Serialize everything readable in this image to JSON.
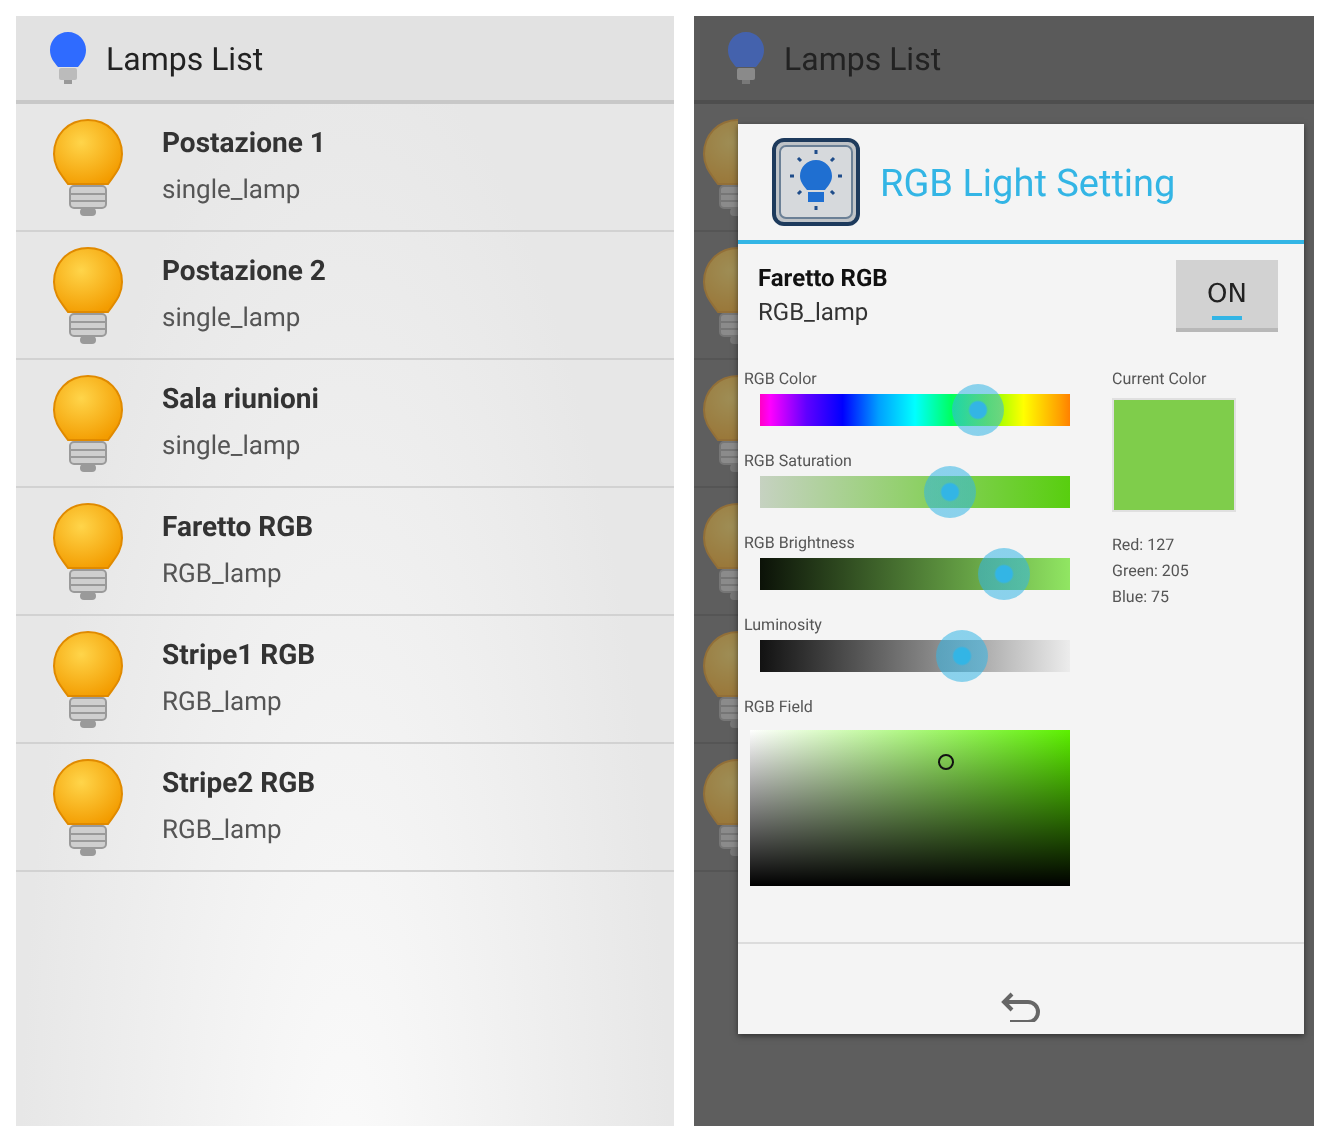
{
  "lamps_screen": {
    "title": "Lamps List",
    "lamps": [
      {
        "name": "Postazione 1",
        "type": "single_lamp"
      },
      {
        "name": "Postazione 2",
        "type": "single_lamp"
      },
      {
        "name": "Sala riunioni",
        "type": "single_lamp"
      },
      {
        "name": "Faretto RGB",
        "type": "RGB_lamp"
      },
      {
        "name": "Stripe1 RGB",
        "type": "RGB_lamp"
      },
      {
        "name": "Stripe2 RGB",
        "type": "RGB_lamp"
      }
    ]
  },
  "settings_screen": {
    "background_title": "Lamps List",
    "dialog": {
      "title": "RGB Light Setting",
      "lamp_name": "Faretto RGB",
      "lamp_type": "RGB_lamp",
      "power": {
        "label": "ON",
        "on": true
      },
      "sliders": [
        {
          "kind": "hue",
          "label": "RGB Color",
          "level": 0.7
        },
        {
          "kind": "saturation",
          "label": "RGB Saturation",
          "level": 0.61
        },
        {
          "kind": "brightness",
          "label": "RGB Brightness",
          "level": 0.79
        },
        {
          "kind": "luminosity",
          "label": "Luminosity",
          "level": 0.65
        }
      ],
      "field_label": "RGB Field",
      "current_color": {
        "label": "Current Color",
        "color": "#7fcd4b",
        "values": [
          "Red: 127",
          "Green: 205",
          "Blue: 75"
        ]
      }
    }
  }
}
